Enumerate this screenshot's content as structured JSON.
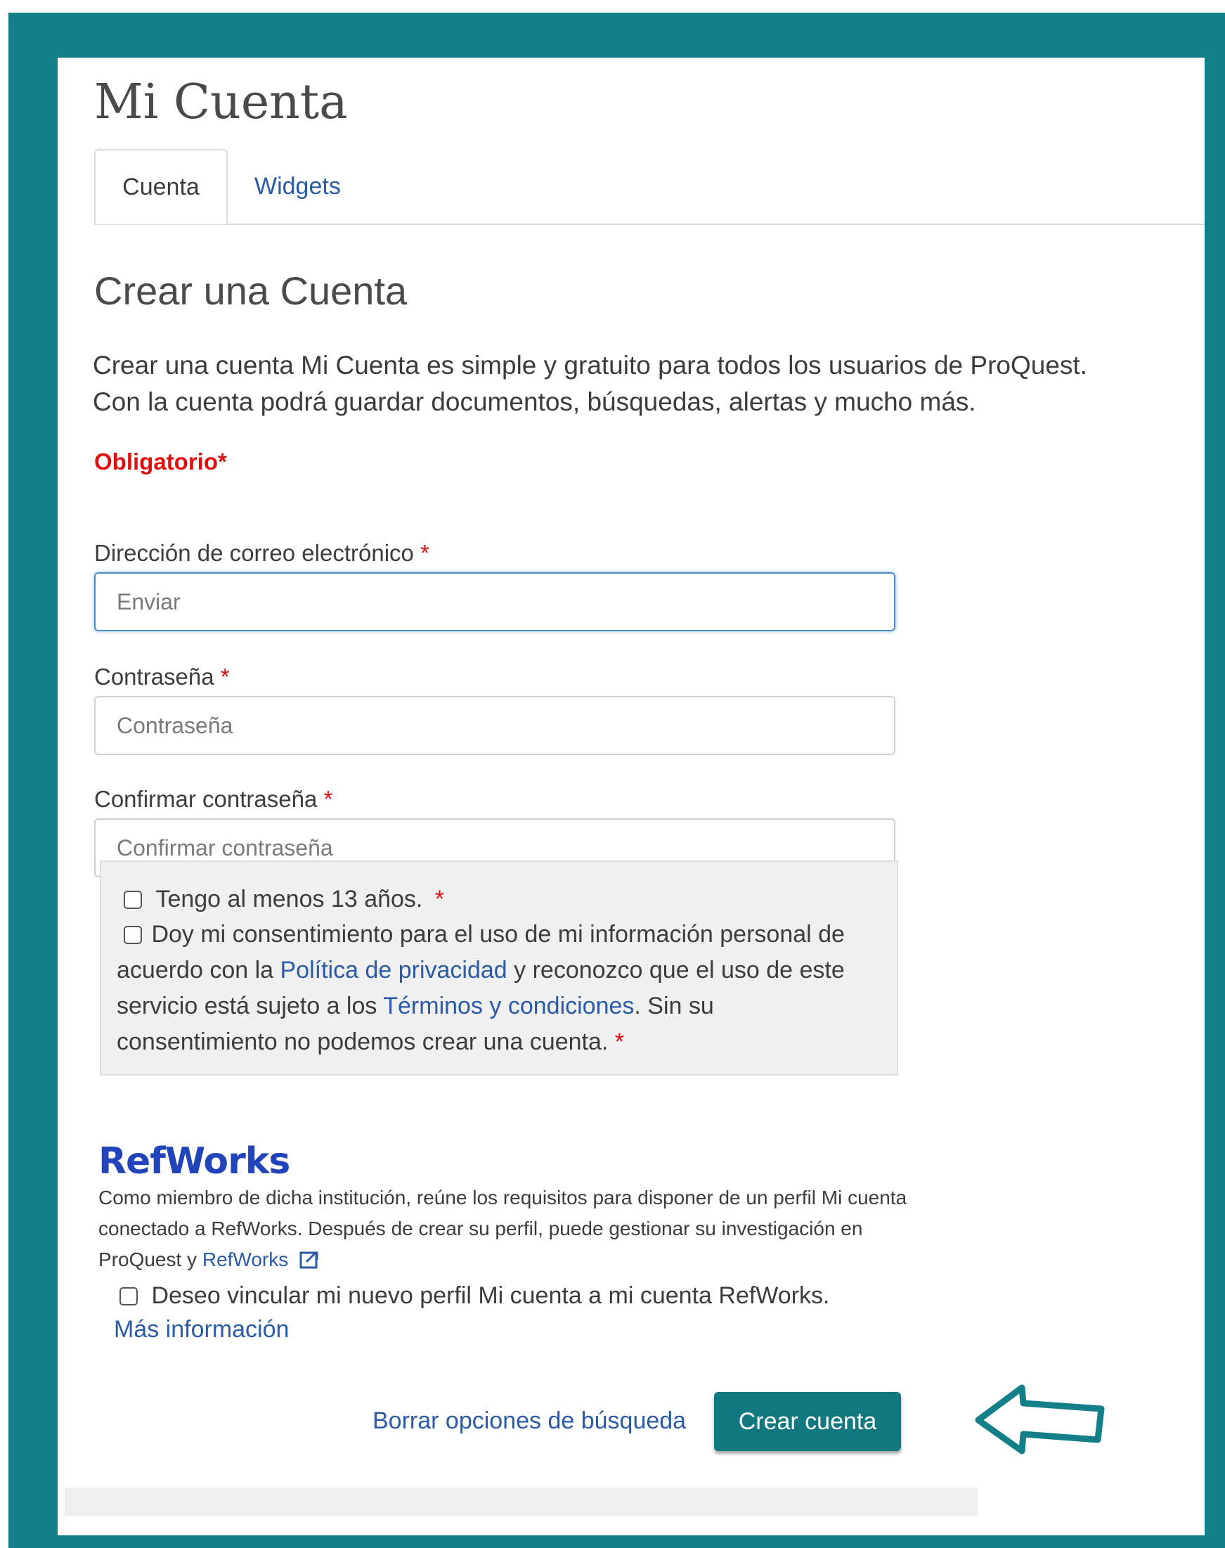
{
  "header": {
    "title": "Mi Cuenta",
    "tabs": [
      {
        "label": "Cuenta",
        "active": true
      },
      {
        "label": "Widgets",
        "active": false
      }
    ]
  },
  "form": {
    "heading": "Crear una Cuenta",
    "intro_line1": "Crear una cuenta Mi Cuenta es simple y gratuito para todos los usuarios de ProQuest.",
    "intro_line2": "Con la cuenta podrá guardar documentos, búsquedas, alertas y mucho más.",
    "required_note": "Obligatorio*",
    "required_marker": "*",
    "email": {
      "label": "Dirección de correo electrónico",
      "placeholder": "Enviar"
    },
    "password": {
      "label": "Contraseña",
      "placeholder": "Contraseña"
    },
    "confirm_password": {
      "label": "Confirmar contraseña",
      "placeholder": "Confirmar contraseña"
    },
    "consent": {
      "age_label": "Tengo al menos 13 años.",
      "consent_part1": "Doy mi consentimiento para el uso de mi información personal de acuerdo con la",
      "privacy_link": "Política de privacidad",
      "consent_part2": "y reconozco que el uso de este servicio está sujeto a los",
      "terms_link": "Términos y condiciones",
      "consent_part3": ". Sin su consentimiento no podemos crear una cuenta."
    }
  },
  "refworks": {
    "logo_text": "RefWorks",
    "description": "Como miembro de dicha institución, reúne los requisitos para disponer de un perfil Mi cuenta conectado a RefWorks. Después de crear su perfil, puede gestionar su investigación en ProQuest y",
    "link": "RefWorks",
    "link_checkbox_label": "Deseo vincular mi nuevo perfil Mi cuenta a mi cuenta RefWorks.",
    "more_info": "Más información"
  },
  "actions": {
    "clear_label": "Borrar opciones de búsqueda",
    "create_label": "Crear cuenta"
  },
  "colors": {
    "frame": "#138089",
    "button": "#12787f",
    "link": "#2a5aa8",
    "required": "#e01010",
    "refworks_logo": "#2244bb"
  },
  "icons": [
    "external-link-icon",
    "left-arrow-icon"
  ]
}
